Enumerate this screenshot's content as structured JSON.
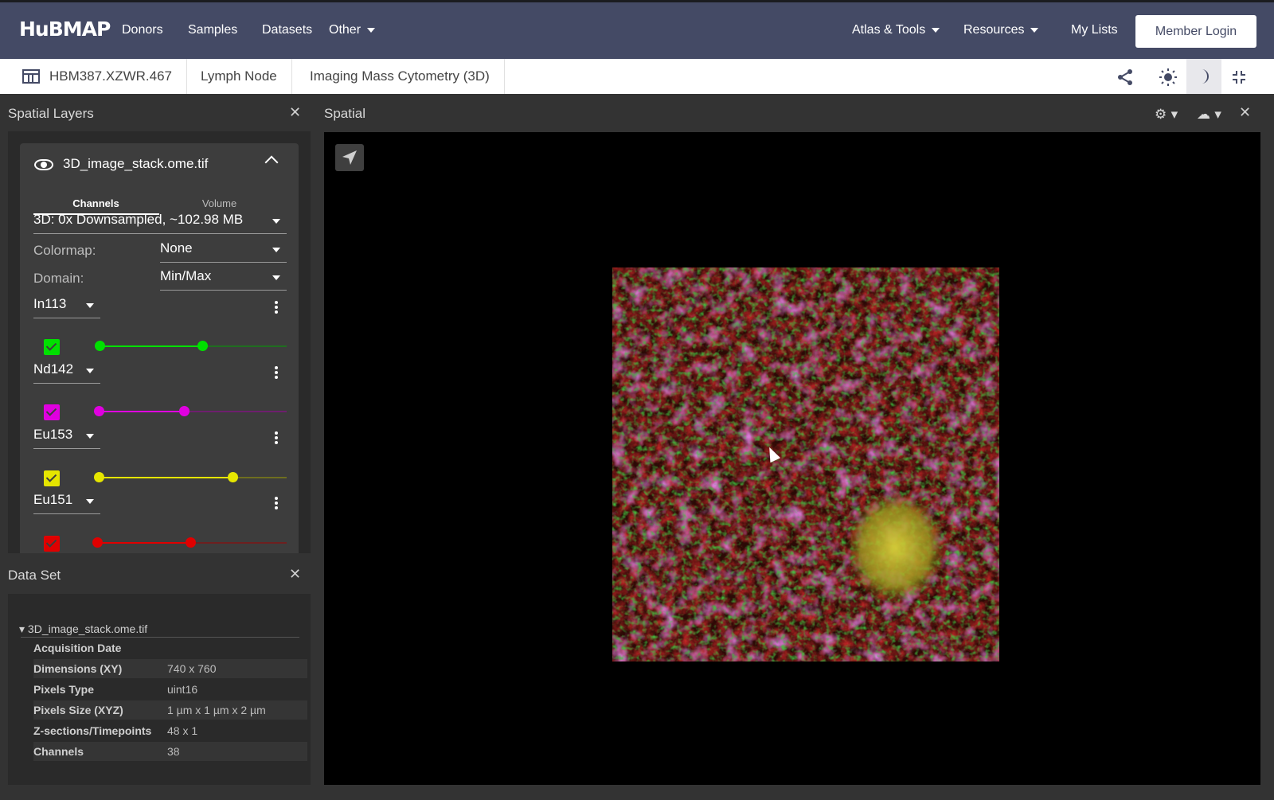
{
  "nav": {
    "logo": "HuBMAP",
    "links": [
      "Donors",
      "Samples",
      "Datasets"
    ],
    "other": "Other",
    "atlas": "Atlas & Tools",
    "resources": "Resources",
    "my_lists": "My Lists",
    "login": "Member Login"
  },
  "breadcrumb": {
    "dataset_id": "HBM387.XZWR.467",
    "organ": "Lymph Node",
    "assay": "Imaging Mass Cytometry (3D)"
  },
  "spatial_layers": {
    "title": "Spatial Layers",
    "file": "3D_image_stack.ome.tif",
    "tabs": [
      "Channels",
      "Volume"
    ],
    "resolution": "3D: 0x Downsampled, ~102.98 MB",
    "colormap_label": "Colormap:",
    "colormap_value": "None",
    "domain_label": "Domain:",
    "domain_value": "Min/Max",
    "channels": [
      {
        "name": "In113",
        "color": "#00e000",
        "range": [
          0.0,
          0.56
        ]
      },
      {
        "name": "Nd142",
        "color": "#e000e0",
        "range": [
          0.0,
          0.46
        ]
      },
      {
        "name": "Eu153",
        "color": "#e6e600",
        "range": [
          0.0,
          0.72
        ]
      },
      {
        "name": "Eu151",
        "color": "#e00000",
        "range": [
          0.0,
          0.51
        ]
      }
    ]
  },
  "dataset": {
    "title": "Data Set",
    "file": "3D_image_stack.ome.tif",
    "rows": [
      {
        "key": "Acquisition Date",
        "value": ""
      },
      {
        "key": "Dimensions (XY)",
        "value": "740 x 760"
      },
      {
        "key": "Pixels Type",
        "value": "uint16"
      },
      {
        "key": "Pixels Size (XYZ)",
        "value": "1 µm x 1 µm x 2 µm"
      },
      {
        "key": "Z-sections/Timepoints",
        "value": "48 x 1"
      },
      {
        "key": "Channels",
        "value": "38"
      }
    ]
  },
  "spatial": {
    "title": "Spatial"
  }
}
